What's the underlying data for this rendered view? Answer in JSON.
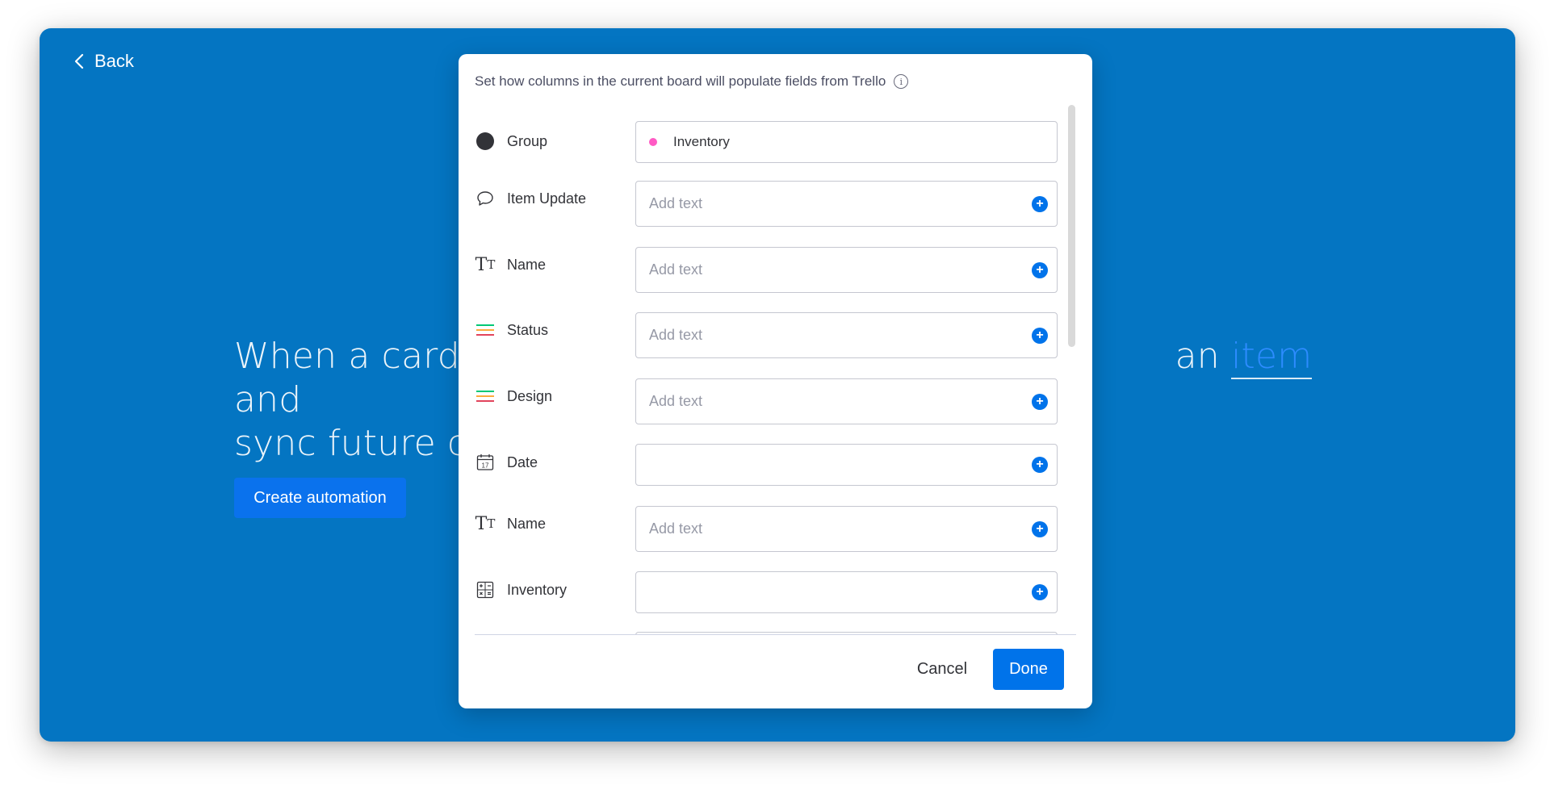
{
  "page": {
    "back_label": "Back",
    "headline_part1": "When a card is",
    "headline_part2": "an",
    "headline_keyword": "item",
    "headline_part3": "and",
    "headline_line2": "sync future cha",
    "create_button": "Create automation"
  },
  "modal": {
    "header": "Set how columns in the current board will populate fields from Trello",
    "rows": [
      {
        "label": "Group",
        "icon": "group-dot-icon",
        "value": "Inventory",
        "placeholder": ""
      },
      {
        "label": "Item Update",
        "icon": "speech-bubble-icon",
        "value": "",
        "placeholder": "Add text"
      },
      {
        "label": "Name",
        "icon": "text-type-icon",
        "value": "",
        "placeholder": "Add text"
      },
      {
        "label": "Status",
        "icon": "status-lines-icon",
        "value": "",
        "placeholder": "Add text"
      },
      {
        "label": "Design",
        "icon": "status-lines-icon",
        "value": "",
        "placeholder": "Add text"
      },
      {
        "label": "Date",
        "icon": "calendar-icon",
        "value": "",
        "placeholder": ""
      },
      {
        "label": "Name",
        "icon": "text-type-icon",
        "value": "",
        "placeholder": "Add text"
      },
      {
        "label": "Inventory",
        "icon": "formula-icon",
        "value": "",
        "placeholder": ""
      }
    ],
    "cancel_button": "Cancel",
    "done_button": "Done"
  },
  "colors": {
    "background_blue": "#0475c2",
    "primary": "#0073ea",
    "group_pink": "#ff5ac4"
  }
}
